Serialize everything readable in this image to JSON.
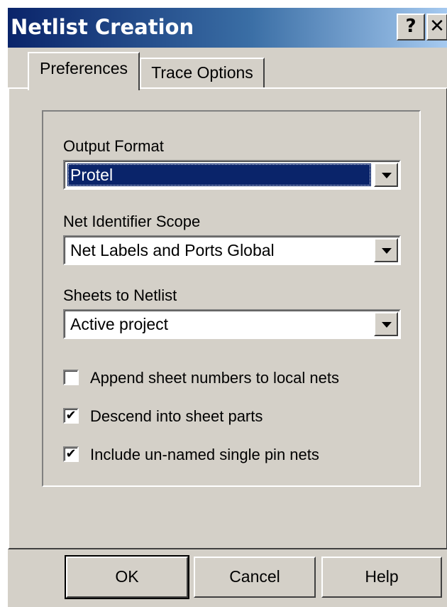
{
  "window": {
    "title": "Netlist Creation",
    "help_button": "?",
    "close_button": "✕"
  },
  "tabs": [
    {
      "label": "Preferences",
      "active": true
    },
    {
      "label": "Trace Options",
      "active": false
    }
  ],
  "preferences": {
    "output_format": {
      "label": "Output Format",
      "value": "Protel"
    },
    "net_identifier_scope": {
      "label": "Net Identifier Scope",
      "value": "Net Labels and Ports Global"
    },
    "sheets_to_netlist": {
      "label": "Sheets to Netlist",
      "value": "Active project"
    },
    "checkboxes": [
      {
        "label": "Append sheet numbers to local nets",
        "checked": false,
        "mark": ""
      },
      {
        "label": "Descend into sheet parts",
        "checked": true,
        "mark": "✔"
      },
      {
        "label": "Include un-named single pin nets",
        "checked": true,
        "mark": "✔"
      }
    ]
  },
  "buttons": {
    "ok": "OK",
    "cancel": "Cancel",
    "help": "Help"
  },
  "colors": {
    "titlebar_start": "#0a246a",
    "titlebar_end": "#a6caf0",
    "face": "#d4d0c8",
    "selection": "#0a246a"
  }
}
